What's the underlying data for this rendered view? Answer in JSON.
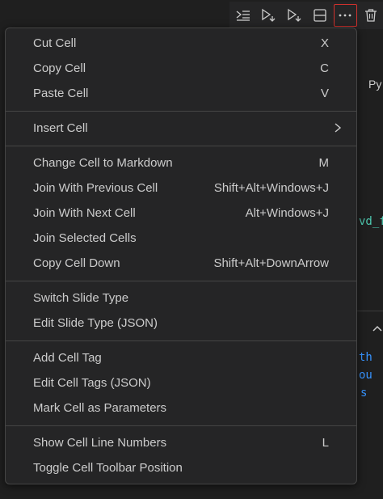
{
  "toolbar": {
    "buttons": [
      {
        "name": "execute-above-icon"
      },
      {
        "name": "run-cell-and-below-icon"
      },
      {
        "name": "run-cell-and-above-icon"
      },
      {
        "name": "split-cell-icon"
      },
      {
        "name": "more-actions-icon"
      },
      {
        "name": "delete-cell-icon"
      }
    ]
  },
  "background": {
    "py_fragment": "Py",
    "vd_fragment": "vd_f",
    "th_fragment": "th",
    "ou_fragment": "ou",
    "s_fragment": "s"
  },
  "menu": {
    "groups": [
      [
        {
          "label": "Cut Cell",
          "shortcut": "X"
        },
        {
          "label": "Copy Cell",
          "shortcut": "C"
        },
        {
          "label": "Paste Cell",
          "shortcut": "V"
        }
      ],
      [
        {
          "label": "Insert Cell",
          "submenu": true
        }
      ],
      [
        {
          "label": "Change Cell to Markdown",
          "shortcut": "M"
        },
        {
          "label": "Join With Previous Cell",
          "shortcut": "Shift+Alt+Windows+J"
        },
        {
          "label": "Join With Next Cell",
          "shortcut": "Alt+Windows+J"
        },
        {
          "label": "Join Selected Cells",
          "shortcut": ""
        },
        {
          "label": "Copy Cell Down",
          "shortcut": "Shift+Alt+DownArrow"
        }
      ],
      [
        {
          "label": "Switch Slide Type",
          "shortcut": ""
        },
        {
          "label": "Edit Slide Type (JSON)",
          "shortcut": ""
        }
      ],
      [
        {
          "label": "Add Cell Tag",
          "shortcut": ""
        },
        {
          "label": "Edit Cell Tags (JSON)",
          "shortcut": ""
        },
        {
          "label": "Mark Cell as Parameters",
          "shortcut": ""
        }
      ],
      [
        {
          "label": "Show Cell Line Numbers",
          "shortcut": "L"
        },
        {
          "label": "Toggle Cell Toolbar Position",
          "shortcut": ""
        }
      ]
    ]
  },
  "colors": {
    "menu_bg": "#252526",
    "menu_text": "#cccccc",
    "separator": "#454545",
    "highlight_border": "#d0312d"
  }
}
